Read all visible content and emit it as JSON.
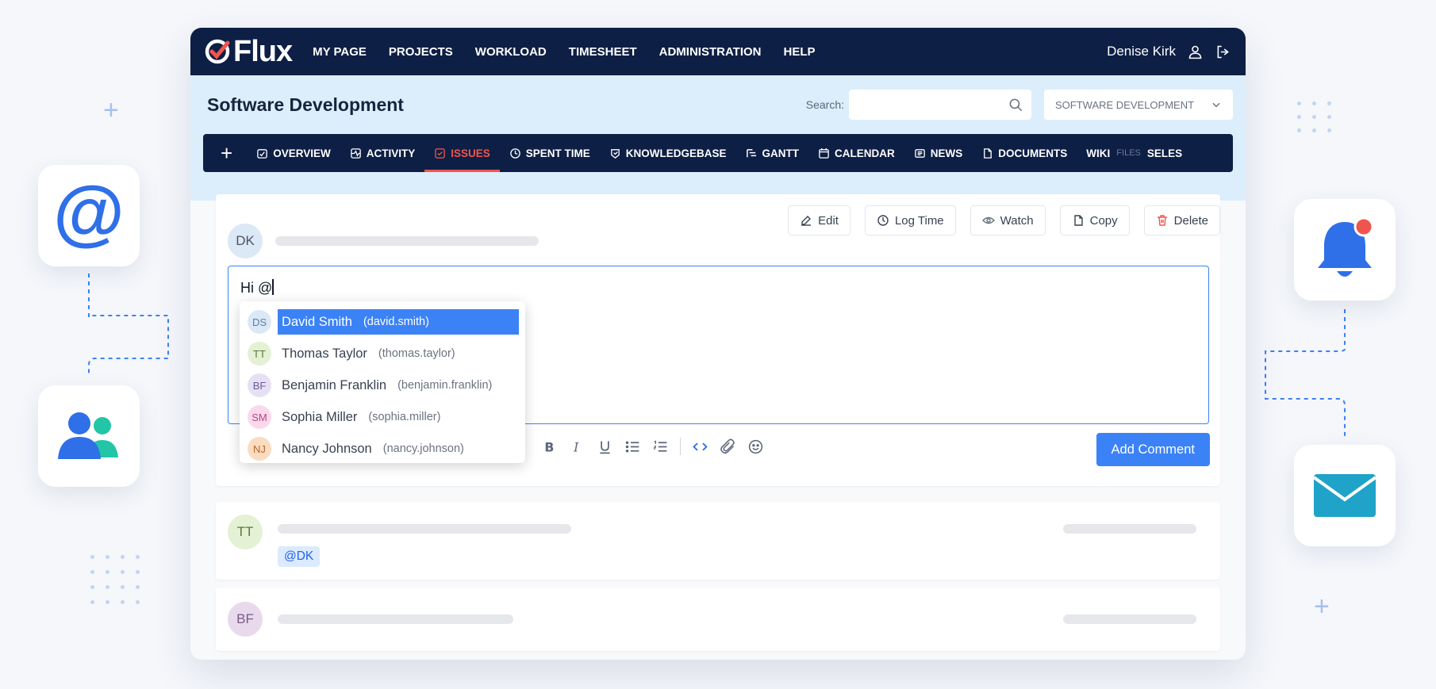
{
  "brand": {
    "name": "Flux",
    "accent": "#f0554d",
    "navy": "#0e1f45",
    "blue": "#3b82f6"
  },
  "topnav": {
    "items": [
      "MY PAGE",
      "PROJECTS",
      "WORKLOAD",
      "TIMESHEET",
      "ADMINISTRATION",
      "HELP"
    ],
    "user_name": "Denise Kirk",
    "icons": [
      "user-icon",
      "logout-icon"
    ]
  },
  "project": {
    "title": "Software Development",
    "search_label": "Search:",
    "search_value": "",
    "selector_value": "SOFTWARE DEVELOPMENT"
  },
  "project_nav": {
    "tabs": [
      "OVERVIEW",
      "ACTIVITY",
      "ISSUES",
      "SPENT TIME",
      "KNOWLEDGEBASE",
      "GANTT",
      "CALENDAR",
      "NEWS",
      "DOCUMENTS",
      "WIKI",
      "FILES",
      "SELES"
    ],
    "active": "ISSUES"
  },
  "actions": [
    "Edit",
    "Log Time",
    "Watch",
    "Copy",
    "Delete"
  ],
  "comment": {
    "author_initials": "DK",
    "editor_text": "Hi @",
    "submit_label": "Add Comment"
  },
  "mention_suggestions": [
    {
      "initials": "DS",
      "name": "David Smith",
      "username": "(david.smith)",
      "selected": true
    },
    {
      "initials": "TT",
      "name": "Thomas Taylor",
      "username": "(thomas.taylor)",
      "selected": false
    },
    {
      "initials": "BF",
      "name": "Benjamin Franklin",
      "username": "(benjamin.franklin)",
      "selected": false
    },
    {
      "initials": "SM",
      "name": "Sophia Miller",
      "username": "(sophia.miller)",
      "selected": false
    },
    {
      "initials": "NJ",
      "name": "Nancy Johnson",
      "username": "(nancy.johnson)",
      "selected": false
    }
  ],
  "editor_toolbar": [
    "bold-icon",
    "italic-icon",
    "underline-icon",
    "bullet-list-icon",
    "numbered-list-icon",
    "code-icon",
    "attachment-icon",
    "emoji-icon"
  ],
  "threads": [
    {
      "initials": "TT",
      "mention": "@DK"
    },
    {
      "initials": "BF"
    }
  ],
  "side_cards": [
    "at-sign-icon",
    "users-icon",
    "bell-icon",
    "mail-icon"
  ]
}
